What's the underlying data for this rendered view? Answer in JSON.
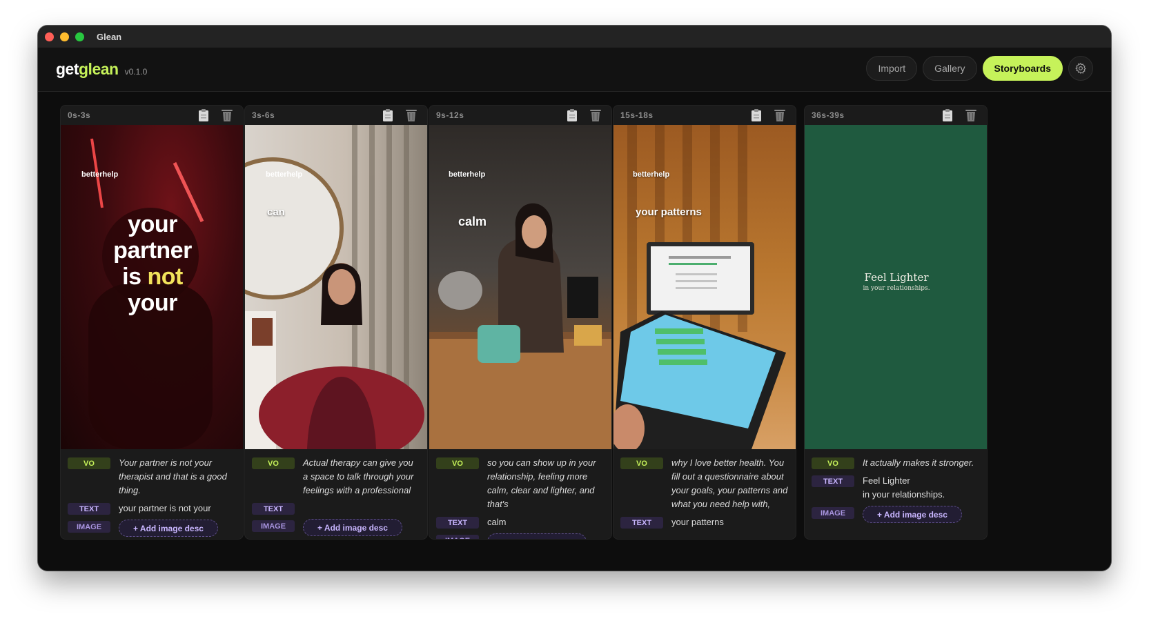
{
  "window": {
    "title": "Glean"
  },
  "header": {
    "logo_part1": "get",
    "logo_part2": "glean",
    "version": "v0.1.0",
    "nav": {
      "import": "Import",
      "gallery": "Gallery",
      "storyboards": "Storyboards"
    },
    "accent_color": "#c6f25a"
  },
  "tags": {
    "vo": "VO",
    "text": "TEXT",
    "image": "IMAGE",
    "add_image": "+ Add image desc"
  },
  "cards": [
    {
      "time": "0s-3s",
      "brand": "betterhelp",
      "overlay_lines": [
        "your",
        "partner",
        "is",
        "not",
        "your"
      ],
      "vo": "Your partner is not your therapist and that is a good thing.",
      "text": "your partner is not your"
    },
    {
      "time": "3s-6s",
      "brand": "betterhelp",
      "overlay": "can",
      "vo": "Actual therapy can give you a space to talk through your feelings with a professional",
      "text": ""
    },
    {
      "time": "9s-12s",
      "brand": "betterhelp",
      "overlay": "calm",
      "vo": "so you can show up in your relationship, feeling more calm, clear and lighter, and that's",
      "text": "calm"
    },
    {
      "time": "15s-18s",
      "brand": "betterhelp",
      "overlay": "your patterns",
      "vo": "why I love better health. You fill out a questionnaire about your goals, your patterns and what you need help with,",
      "text": "your patterns"
    },
    {
      "time": "36s-39s",
      "overlay_title": "Feel Lighter",
      "overlay_sub": "in your relationships.",
      "vo": "It actually makes it stronger.",
      "text_line1": "Feel Lighter",
      "text_line2": "in your relationships."
    }
  ]
}
